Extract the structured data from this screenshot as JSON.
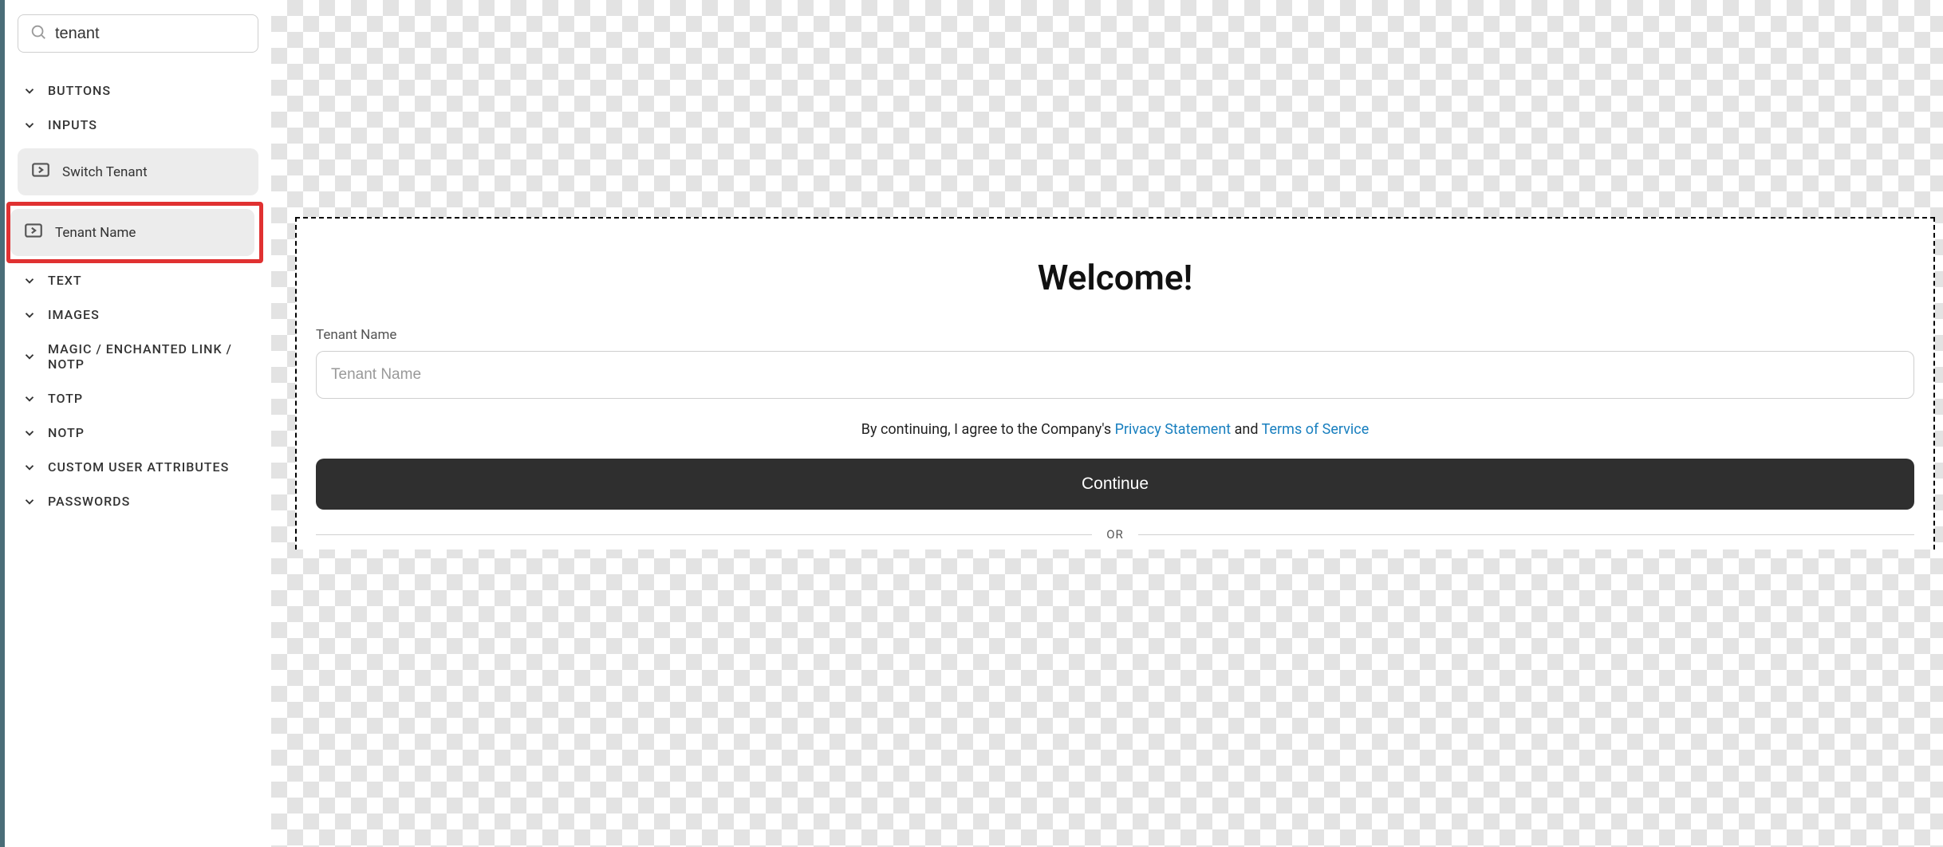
{
  "sidebar": {
    "search_value": "tenant",
    "categories": {
      "buttons": "Buttons",
      "inputs": "Inputs",
      "text": "Text",
      "images": "Images",
      "magic": "Magic / Enchanted Link / NOTP",
      "totp": "TOTP",
      "notp": "NOTP",
      "custom_attrs": "Custom User Attributes",
      "passwords": "Passwords"
    },
    "inputs_items": {
      "switch_tenant": "Switch Tenant",
      "tenant_name": "Tenant Name"
    }
  },
  "form": {
    "title": "Welcome!",
    "tenant_label": "Tenant Name",
    "tenant_placeholder": "Tenant Name",
    "consent_prefix": "By continuing, I agree to the Company's ",
    "privacy_link": "Privacy Statement",
    "consent_mid": " and ",
    "tos_link": "Terms of Service",
    "continue_label": "Continue",
    "divider_label": "OR"
  }
}
